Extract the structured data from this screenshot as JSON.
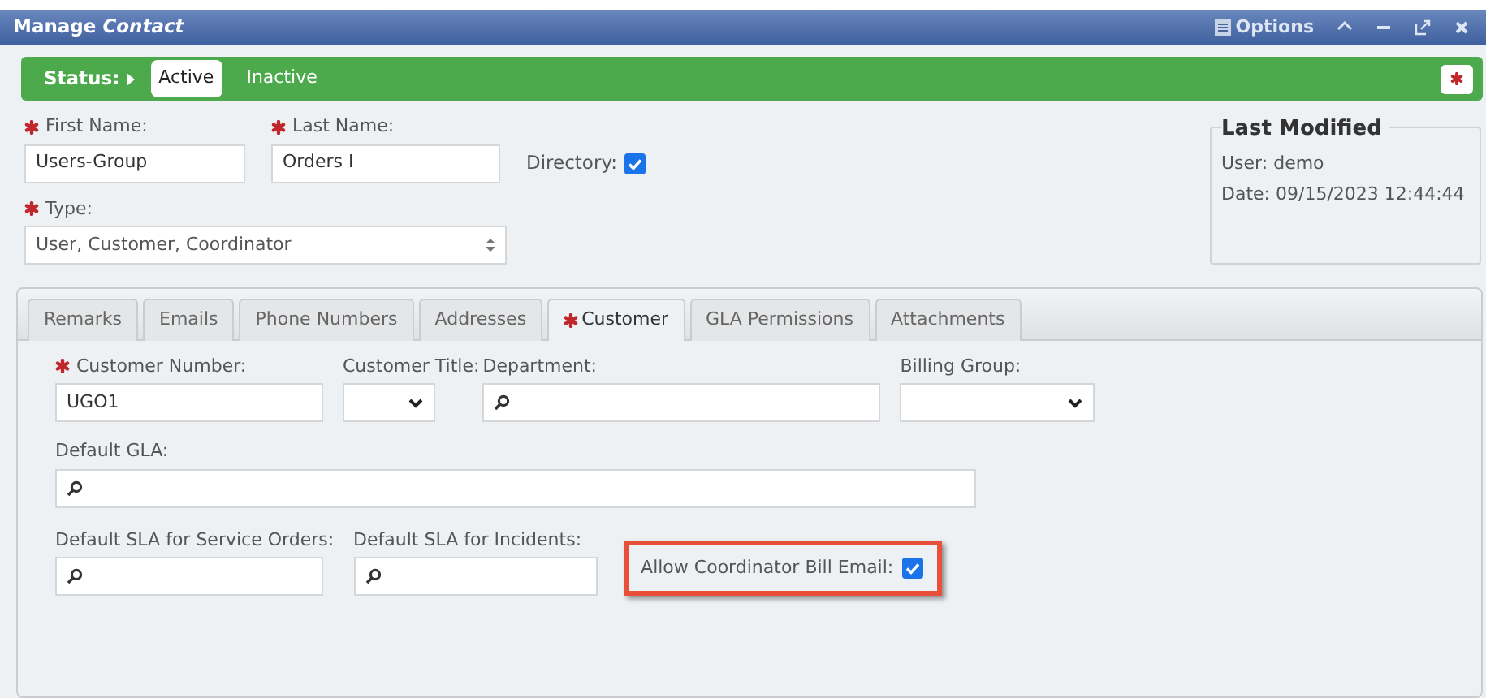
{
  "window": {
    "title": "Manage *Contact*",
    "options_label": "Options"
  },
  "status": {
    "label": "Status:",
    "options": [
      {
        "label": "Active",
        "selected": true
      },
      {
        "label": "Inactive",
        "selected": false
      }
    ]
  },
  "contact": [
    {
      "kind": "text",
      "label": "First Name:",
      "required": true,
      "value": "Users-Group"
    },
    {
      "kind": "text",
      "label": "Last Name:",
      "required": true,
      "value": "Orders I"
    },
    {
      "kind": "checkbox",
      "label": "Directory:",
      "required": false,
      "checked": true
    }
  ],
  "type": {
    "label": "Type:",
    "required": true,
    "value": "User, Customer, Coordinator"
  },
  "last_modified": {
    "title": "Last Modified",
    "user": "User: demo",
    "date": "Date: 09/15/2023 12:44:44"
  },
  "tabs": [
    {
      "label": "Remarks",
      "required": false,
      "selected": false
    },
    {
      "label": "Emails",
      "required": false,
      "selected": false
    },
    {
      "label": "Phone Numbers",
      "required": false,
      "selected": false
    },
    {
      "label": "Addresses",
      "required": false,
      "selected": false
    },
    {
      "label": "Customer",
      "required": true,
      "selected": true
    },
    {
      "label": "GLA Permissions",
      "required": false,
      "selected": false
    },
    {
      "label": "Attachments",
      "required": false,
      "selected": false
    }
  ],
  "customer_rows": [
    [
      {
        "kind": "text",
        "label": "Customer Number:",
        "required": true,
        "value": "UGO1"
      },
      {
        "kind": "select",
        "label": "Customer Title:",
        "required": false
      },
      {
        "kind": "lookup",
        "label": "Department:",
        "required": false
      },
      {
        "kind": "select",
        "label": "Billing Group:",
        "required": false
      }
    ],
    [
      {
        "kind": "lookup",
        "label": "Default GLA:",
        "required": false
      }
    ],
    [
      {
        "kind": "lookup",
        "label": "Default SLA for Service Orders:",
        "required": false
      },
      {
        "kind": "lookup",
        "label": "Default SLA for Incidents:",
        "required": false
      },
      {
        "kind": "checkbox",
        "label": "Allow Coordinator Bill Email:",
        "required": false,
        "checked": true,
        "highlighted": true
      }
    ]
  ]
}
